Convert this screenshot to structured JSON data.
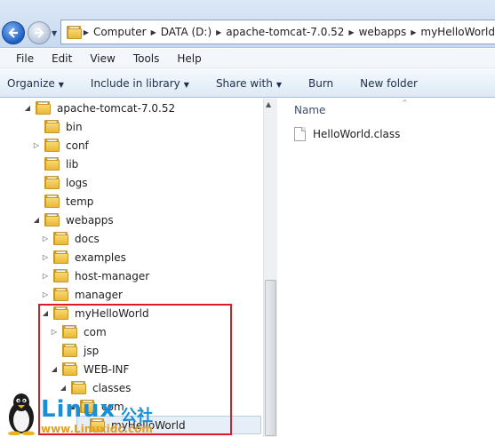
{
  "breadcrumbs": [
    "Computer",
    "DATA (D:)",
    "apache-tomcat-7.0.52",
    "webapps",
    "myHelloWorld"
  ],
  "menu": [
    "File",
    "Edit",
    "View",
    "Tools",
    "Help"
  ],
  "commands": {
    "organize": "Organize",
    "include": "Include in library",
    "share": "Share with",
    "burn": "Burn",
    "new_folder": "New folder"
  },
  "tree": [
    {
      "label": "apache-tomcat-7.0.52",
      "expander": "expanded"
    },
    {
      "label": "bin",
      "expander": "none"
    },
    {
      "label": "conf",
      "expander": "collapsed"
    },
    {
      "label": "lib",
      "expander": "none"
    },
    {
      "label": "logs",
      "expander": "none"
    },
    {
      "label": "temp",
      "expander": "none"
    },
    {
      "label": "webapps",
      "expander": "expanded"
    },
    {
      "label": "docs",
      "expander": "collapsed"
    },
    {
      "label": "examples",
      "expander": "collapsed"
    },
    {
      "label": "host-manager",
      "expander": "collapsed"
    },
    {
      "label": "manager",
      "expander": "collapsed"
    },
    {
      "label": "myHelloWorld",
      "expander": "expanded"
    },
    {
      "label": "com",
      "expander": "collapsed"
    },
    {
      "label": "jsp",
      "expander": "none"
    },
    {
      "label": "WEB-INF",
      "expander": "expanded"
    },
    {
      "label": "classes",
      "expander": "expanded"
    },
    {
      "label": "com",
      "expander": "expanded"
    },
    {
      "label": "myHelloWorld",
      "expander": "none",
      "selected": true
    }
  ],
  "content": {
    "column_name": "Name",
    "files": [
      "HelloWorld.class"
    ]
  },
  "watermark": {
    "brand": "Linux",
    "brand_cn": "公社",
    "site": "www.Linuxidc.com"
  },
  "colors": {
    "highlight_border": "#e01b24",
    "watermark_blue": "#1a8fd6",
    "watermark_orange": "#e0a020"
  }
}
